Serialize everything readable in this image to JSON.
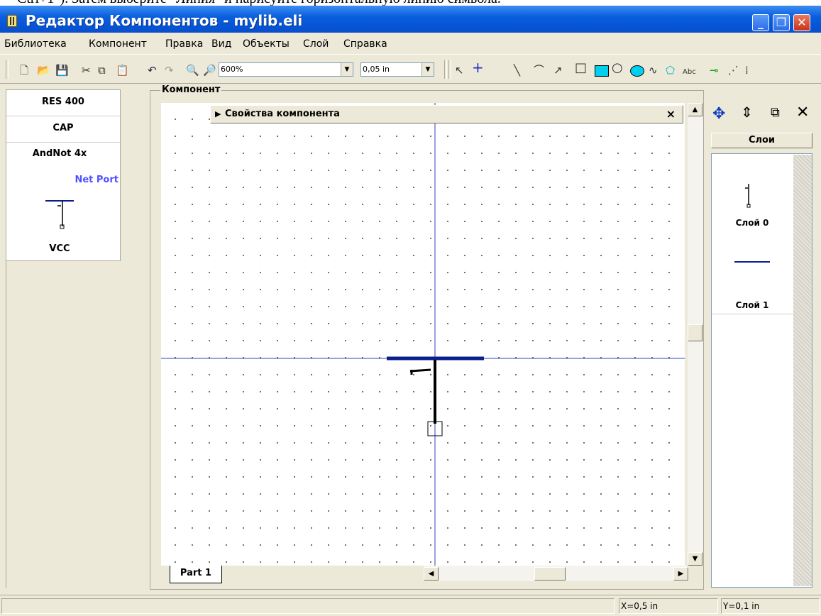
{
  "caption": "Ctrl+1\"). Затем выберите \"Линия\" и нарисуйте горизонтальную линию символа.",
  "window": {
    "title": "Редактор Компонентов - mylib.eli",
    "minimize_glyph": "_",
    "maximize_glyph": "❐",
    "close_glyph": "✕"
  },
  "menu": [
    "Библиотека",
    "Компонент",
    "Правка",
    "Вид",
    "Объекты",
    "Слой",
    "Справка"
  ],
  "toolbar": {
    "zoom_value": "600%",
    "grid_value": "0,05 in",
    "icons": [
      "new-file-icon",
      "open-folder-icon",
      "save-icon",
      "cut-icon",
      "copy-icon",
      "paste-icon",
      "undo-icon",
      "redo-icon",
      "zoom-in-icon",
      "zoom-out-icon",
      "select-arrow-icon",
      "pin-cross-icon",
      "line-tool-icon",
      "arc-tool-icon",
      "arrow-tool-icon",
      "rectangle-tool-icon",
      "filled-rectangle-tool-icon",
      "ellipse-tool-icon",
      "filled-ellipse-tool-icon",
      "polyline-tool-icon",
      "polygon-tool-icon",
      "text-tool-icon",
      "port-tool-icon",
      "bus-tool-icon"
    ],
    "text_tool_label": "Abc"
  },
  "library": {
    "items": [
      "RES 400",
      "CAP",
      "AndNot 4x"
    ],
    "net_port_label": "Net Port",
    "net_port_name": "VCC",
    "accent": "#5050ff"
  },
  "component": {
    "group_label": "Компонент",
    "properties_title": "Свойства компонента",
    "properties_close": "×",
    "tab_label": "Part 1",
    "line_color": "#0a1e8c",
    "axis_color": "#3040c0"
  },
  "layers": {
    "header": "Слои",
    "items": [
      "Слой 0",
      "Слой 1"
    ]
  },
  "status": {
    "x": "X=0,5 in",
    "y": "Y=0,1 in"
  }
}
